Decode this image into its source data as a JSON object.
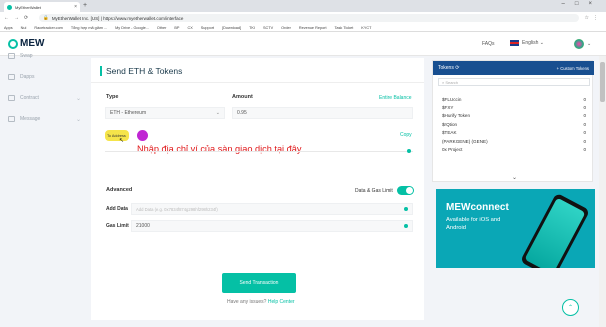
{
  "browser": {
    "tab_title": "MyEtherWallet",
    "url": "MyEtherWallet Inc. [US] | https://www.myetherwallet.com/interface",
    "bookmarks": [
      "Apps",
      "Nui",
      "Racetracker.com",
      "Tổng hợp mã giảm ...",
      "My Drive - Google...",
      "Other",
      "BP",
      "CX",
      "Support",
      "[Download]",
      "TKI",
      "SCTV",
      "Order",
      "Revenue Report",
      "Task Ticket",
      "KYCT"
    ]
  },
  "header": {
    "logo_text": "MEW",
    "faqs": "FAQs",
    "language": "English"
  },
  "sidebar": {
    "items": [
      {
        "label": "Swap"
      },
      {
        "label": "Dapps"
      },
      {
        "label": "Contract"
      },
      {
        "label": "Message"
      }
    ]
  },
  "send_form": {
    "title": "Send ETH & Tokens",
    "type_label": "Type",
    "type_value": "ETH - Ethereum",
    "amount_label": "Amount",
    "entire_balance": "Entire Balance",
    "amount_value": "0.95",
    "to_address_label": "To Address",
    "copy": "Copy",
    "overlay_text": "Nhập địa chỉ ví của sàn giao dịch tại đây",
    "advanced_label": "Advanced",
    "data_gas_limit": "Data & Gas Limit",
    "add_data_label": "Add Data",
    "add_data_placeholder": "Add Data (e.g. 0x7834f874g298hf298h234f)",
    "gas_limit_label": "Gas Limit",
    "gas_limit_value": "21000",
    "send_button": "Send Transaction",
    "issues_text": "Have any issues?",
    "help_center": "Help Center"
  },
  "tokens": {
    "title": "Tokens",
    "custom_tokens": "+ Custom Tokens",
    "search_placeholder": "Search",
    "rows": [
      {
        "name": "$FLUccin",
        "balance": "0"
      },
      {
        "name": "$FXY",
        "balance": "0"
      },
      {
        "name": "$Hurify Token",
        "balance": "0"
      },
      {
        "name": "$rQtion",
        "balance": "0"
      },
      {
        "name": "$TEAK",
        "balance": "0"
      },
      {
        "name": "(PARKGENE) (GENE)",
        "balance": "0"
      },
      {
        "name": "0x Project",
        "balance": "0"
      }
    ]
  },
  "ad": {
    "title": "MEWconnect",
    "subtitle": "Available for iOS and Android"
  },
  "colors": {
    "accent": "#05c0a5",
    "tokens_header": "#184f90",
    "overlay_text": "#e0191b",
    "highlight": "#f5e44a"
  }
}
